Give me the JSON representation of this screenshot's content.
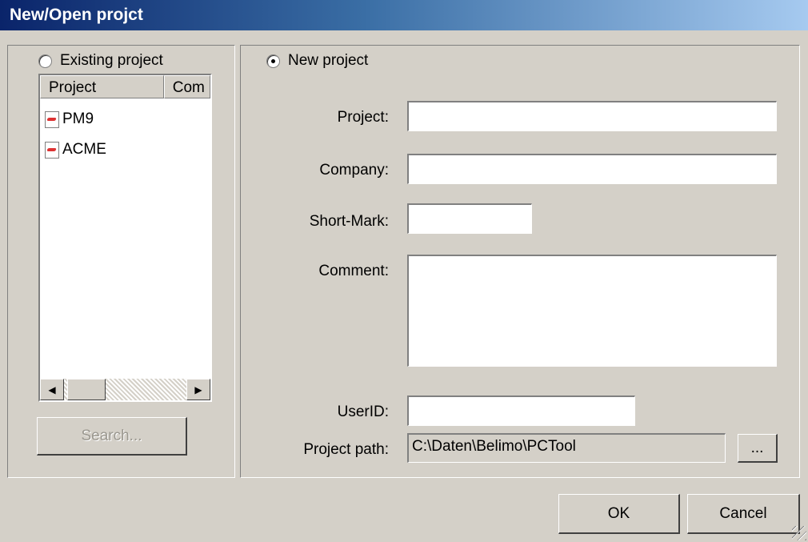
{
  "window": {
    "title": "New/Open projct"
  },
  "existing": {
    "radio_label": "Existing project",
    "columns": [
      "Project",
      "Com"
    ],
    "items": [
      "PM9",
      "ACME"
    ],
    "search_label": "Search..."
  },
  "new_project": {
    "radio_label": "New project",
    "fields": {
      "project": {
        "label": "Project:",
        "value": ""
      },
      "company": {
        "label": "Company:",
        "value": ""
      },
      "short_mark": {
        "label": "Short-Mark:",
        "value": ""
      },
      "comment": {
        "label": "Comment:",
        "value": ""
      },
      "userid": {
        "label": "UserID:",
        "value": ""
      },
      "path": {
        "label": "Project path:",
        "value": "C:\\Daten\\Belimo\\PCTool"
      }
    },
    "browse_label": "..."
  },
  "footer": {
    "ok_label": "OK",
    "cancel_label": "Cancel"
  }
}
